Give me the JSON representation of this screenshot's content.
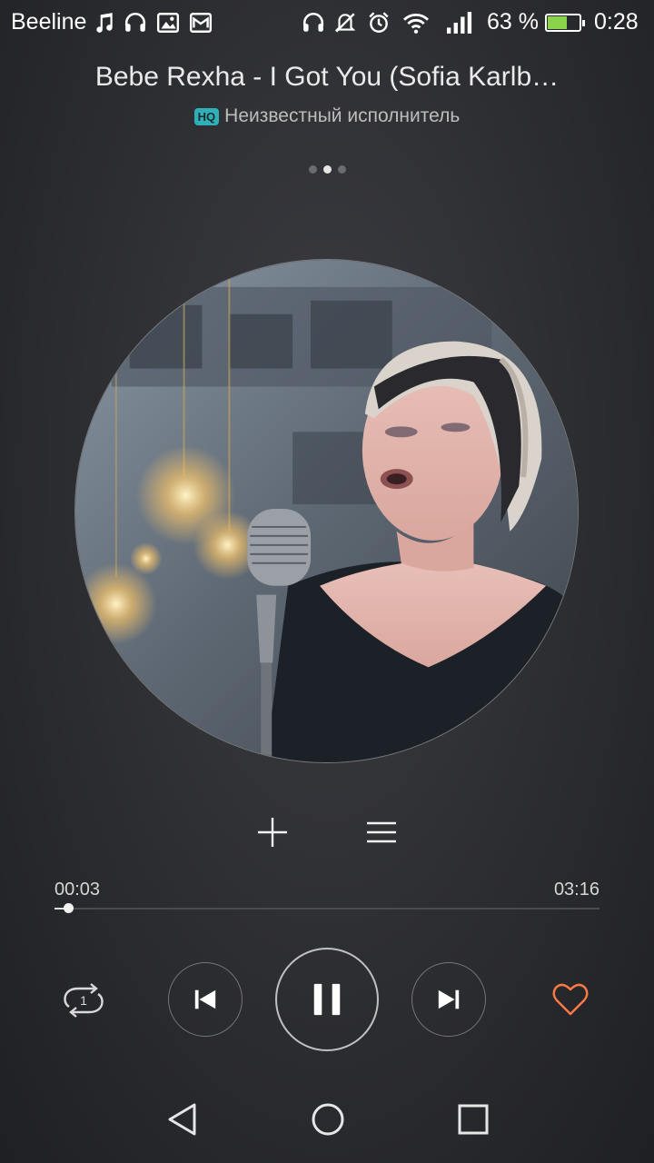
{
  "status_bar": {
    "carrier": "Beeline",
    "battery_percent": "63 %",
    "battery_level": 0.63,
    "time": "0:28",
    "icons": [
      "music-note-icon",
      "headphones-icon",
      "image-icon",
      "mail-icon",
      "headset-icon",
      "mute-icon",
      "alarm-icon",
      "wifi-icon",
      "signal-icon",
      "battery-icon"
    ]
  },
  "player": {
    "title": "Bebe Rexha - I Got You (Sofia Karlb…",
    "quality_badge": "HQ",
    "artist": "Неизвестный исполнитель",
    "page_count": 3,
    "active_page": 1,
    "elapsed": "00:03",
    "duration": "03:16",
    "progress": 0.015,
    "repeat_mode": "repeat-one",
    "repeat_label": "1",
    "accent_color": "#ff7a45"
  },
  "colors": {
    "background": "#2c2d31",
    "hq_badge": "#2fb0b9",
    "battery_fill": "#8bd34a",
    "heart": "#ff7a45"
  }
}
